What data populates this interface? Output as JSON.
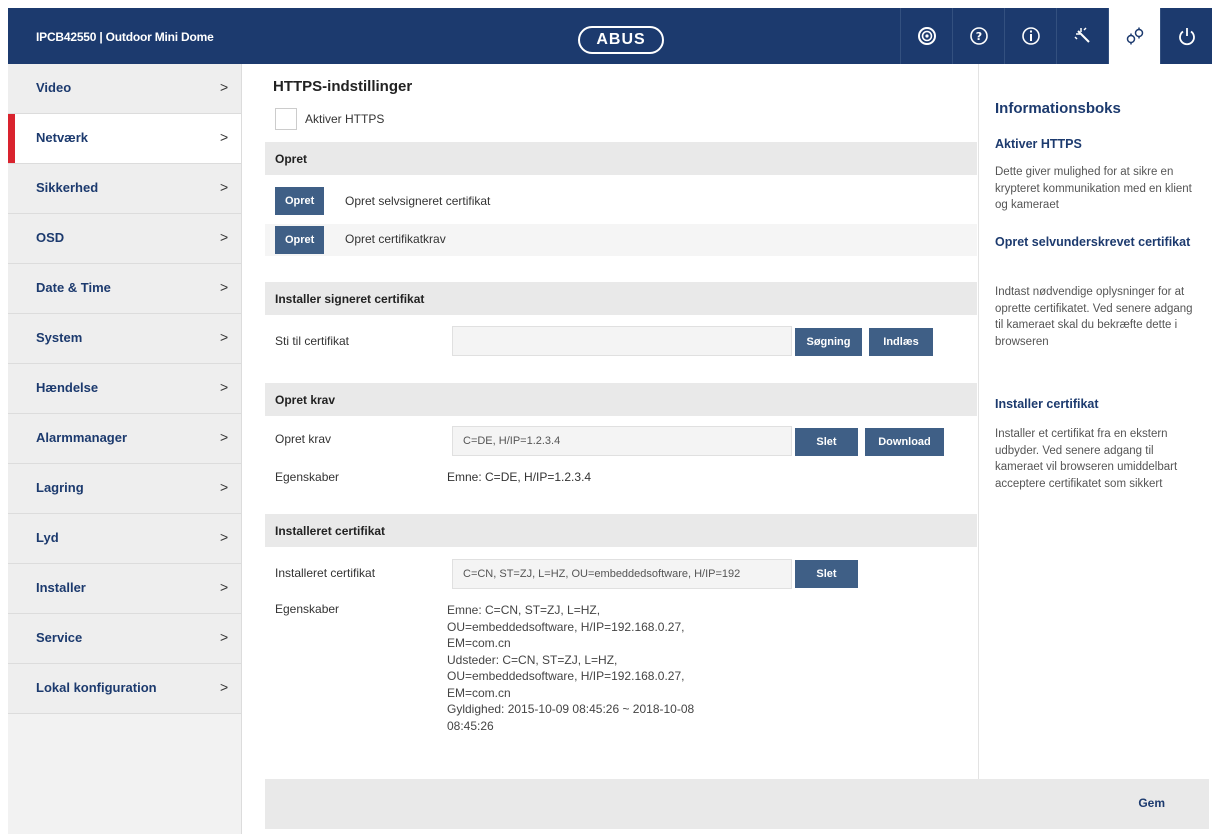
{
  "header": {
    "device_title": "IPCB42550  |  Outdoor Mini Dome",
    "logo_text": "ABUS",
    "icons": [
      "camera-lens-icon",
      "help-icon",
      "info-icon",
      "wand-icon",
      "settings-icon",
      "power-icon"
    ],
    "active_icon": "settings-icon"
  },
  "sidebar": {
    "items": [
      {
        "label": "Video"
      },
      {
        "label": "Netværk",
        "active": true
      },
      {
        "label": "Sikkerhed"
      },
      {
        "label": "OSD"
      },
      {
        "label": "Date & Time"
      },
      {
        "label": "System"
      },
      {
        "label": "Hændelse"
      },
      {
        "label": "Alarmmanager"
      },
      {
        "label": "Lagring"
      },
      {
        "label": "Lyd"
      },
      {
        "label": "Installer"
      },
      {
        "label": "Service"
      },
      {
        "label": "Lokal konfiguration"
      }
    ],
    "chevron": ">"
  },
  "main": {
    "title": "HTTPS-indstillinger",
    "enable_https_label": "Aktiver HTTPS",
    "create": {
      "header": "Opret",
      "button_label": "Opret",
      "self_signed_label": "Opret selvsigneret certifikat",
      "request_label": "Opret certifikatkrav"
    },
    "install_signed": {
      "header": "Installer signeret certifikat",
      "path_label": "Sti til certifikat",
      "path_value": "",
      "browse_label": "Søgning",
      "upload_label": "Indlæs"
    },
    "create_request": {
      "header": "Opret krav",
      "request_label": "Opret krav",
      "request_value": "C=DE, H/IP=1.2.3.4",
      "delete_label": "Slet",
      "download_label": "Download",
      "properties_label": "Egenskaber",
      "properties_value": "Emne: C=DE, H/IP=1.2.3.4"
    },
    "installed": {
      "header": "Installeret certifikat",
      "cert_label": "Installeret certifikat",
      "cert_value": "C=CN, ST=ZJ, L=HZ, OU=embeddedsoftware, H/IP=192",
      "delete_label": "Slet",
      "properties_label": "Egenskaber",
      "properties_lines": [
        "Emne: C=CN, ST=ZJ, L=HZ,",
        "OU=embeddedsoftware, H/IP=192.168.0.27,",
        "EM=com.cn",
        "Udsteder: C=CN, ST=ZJ, L=HZ,",
        "OU=embeddedsoftware, H/IP=192.168.0.27,",
        "EM=com.cn",
        "Gyldighed: 2015-10-09 08:45:26 ~ 2018-10-08",
        "08:45:26"
      ]
    },
    "save_label": "Gem"
  },
  "info": {
    "title": "Informationsboks",
    "sections": [
      {
        "heading": "Aktiver HTTPS",
        "text": "Dette giver mulighed for at sikre en krypteret kommunikation med en klient og kameraet"
      },
      {
        "heading": "Opret selvunderskrevet certifikat",
        "text": "Indtast nødvendige oplysninger for at oprette certifikatet. Ved senere adgang til kameraet skal du bekræfte dette i browseren"
      },
      {
        "heading": "Installer certifikat",
        "text": "Installer et certifikat fra en ekstern udbyder. Ved senere adgang til kameraet vil browseren umiddelbart acceptere certifikatet som sikkert"
      }
    ]
  },
  "colors": {
    "header_bg": "#1c3a6e",
    "button_bg": "#3f5f86",
    "active_accent": "#d9232e"
  }
}
